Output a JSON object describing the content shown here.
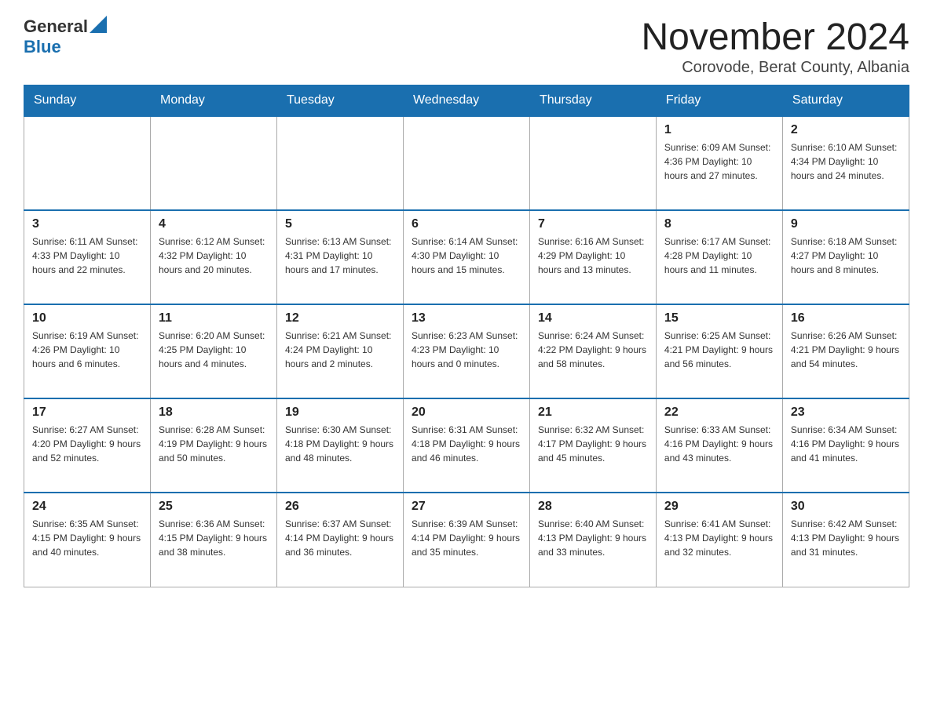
{
  "header": {
    "logo_general": "General",
    "logo_blue": "Blue",
    "title": "November 2024",
    "subtitle": "Corovode, Berat County, Albania"
  },
  "weekdays": [
    "Sunday",
    "Monday",
    "Tuesday",
    "Wednesday",
    "Thursday",
    "Friday",
    "Saturday"
  ],
  "weeks": [
    [
      {
        "day": "",
        "info": ""
      },
      {
        "day": "",
        "info": ""
      },
      {
        "day": "",
        "info": ""
      },
      {
        "day": "",
        "info": ""
      },
      {
        "day": "",
        "info": ""
      },
      {
        "day": "1",
        "info": "Sunrise: 6:09 AM\nSunset: 4:36 PM\nDaylight: 10 hours and 27 minutes."
      },
      {
        "day": "2",
        "info": "Sunrise: 6:10 AM\nSunset: 4:34 PM\nDaylight: 10 hours and 24 minutes."
      }
    ],
    [
      {
        "day": "3",
        "info": "Sunrise: 6:11 AM\nSunset: 4:33 PM\nDaylight: 10 hours and 22 minutes."
      },
      {
        "day": "4",
        "info": "Sunrise: 6:12 AM\nSunset: 4:32 PM\nDaylight: 10 hours and 20 minutes."
      },
      {
        "day": "5",
        "info": "Sunrise: 6:13 AM\nSunset: 4:31 PM\nDaylight: 10 hours and 17 minutes."
      },
      {
        "day": "6",
        "info": "Sunrise: 6:14 AM\nSunset: 4:30 PM\nDaylight: 10 hours and 15 minutes."
      },
      {
        "day": "7",
        "info": "Sunrise: 6:16 AM\nSunset: 4:29 PM\nDaylight: 10 hours and 13 minutes."
      },
      {
        "day": "8",
        "info": "Sunrise: 6:17 AM\nSunset: 4:28 PM\nDaylight: 10 hours and 11 minutes."
      },
      {
        "day": "9",
        "info": "Sunrise: 6:18 AM\nSunset: 4:27 PM\nDaylight: 10 hours and 8 minutes."
      }
    ],
    [
      {
        "day": "10",
        "info": "Sunrise: 6:19 AM\nSunset: 4:26 PM\nDaylight: 10 hours and 6 minutes."
      },
      {
        "day": "11",
        "info": "Sunrise: 6:20 AM\nSunset: 4:25 PM\nDaylight: 10 hours and 4 minutes."
      },
      {
        "day": "12",
        "info": "Sunrise: 6:21 AM\nSunset: 4:24 PM\nDaylight: 10 hours and 2 minutes."
      },
      {
        "day": "13",
        "info": "Sunrise: 6:23 AM\nSunset: 4:23 PM\nDaylight: 10 hours and 0 minutes."
      },
      {
        "day": "14",
        "info": "Sunrise: 6:24 AM\nSunset: 4:22 PM\nDaylight: 9 hours and 58 minutes."
      },
      {
        "day": "15",
        "info": "Sunrise: 6:25 AM\nSunset: 4:21 PM\nDaylight: 9 hours and 56 minutes."
      },
      {
        "day": "16",
        "info": "Sunrise: 6:26 AM\nSunset: 4:21 PM\nDaylight: 9 hours and 54 minutes."
      }
    ],
    [
      {
        "day": "17",
        "info": "Sunrise: 6:27 AM\nSunset: 4:20 PM\nDaylight: 9 hours and 52 minutes."
      },
      {
        "day": "18",
        "info": "Sunrise: 6:28 AM\nSunset: 4:19 PM\nDaylight: 9 hours and 50 minutes."
      },
      {
        "day": "19",
        "info": "Sunrise: 6:30 AM\nSunset: 4:18 PM\nDaylight: 9 hours and 48 minutes."
      },
      {
        "day": "20",
        "info": "Sunrise: 6:31 AM\nSunset: 4:18 PM\nDaylight: 9 hours and 46 minutes."
      },
      {
        "day": "21",
        "info": "Sunrise: 6:32 AM\nSunset: 4:17 PM\nDaylight: 9 hours and 45 minutes."
      },
      {
        "day": "22",
        "info": "Sunrise: 6:33 AM\nSunset: 4:16 PM\nDaylight: 9 hours and 43 minutes."
      },
      {
        "day": "23",
        "info": "Sunrise: 6:34 AM\nSunset: 4:16 PM\nDaylight: 9 hours and 41 minutes."
      }
    ],
    [
      {
        "day": "24",
        "info": "Sunrise: 6:35 AM\nSunset: 4:15 PM\nDaylight: 9 hours and 40 minutes."
      },
      {
        "day": "25",
        "info": "Sunrise: 6:36 AM\nSunset: 4:15 PM\nDaylight: 9 hours and 38 minutes."
      },
      {
        "day": "26",
        "info": "Sunrise: 6:37 AM\nSunset: 4:14 PM\nDaylight: 9 hours and 36 minutes."
      },
      {
        "day": "27",
        "info": "Sunrise: 6:39 AM\nSunset: 4:14 PM\nDaylight: 9 hours and 35 minutes."
      },
      {
        "day": "28",
        "info": "Sunrise: 6:40 AM\nSunset: 4:13 PM\nDaylight: 9 hours and 33 minutes."
      },
      {
        "day": "29",
        "info": "Sunrise: 6:41 AM\nSunset: 4:13 PM\nDaylight: 9 hours and 32 minutes."
      },
      {
        "day": "30",
        "info": "Sunrise: 6:42 AM\nSunset: 4:13 PM\nDaylight: 9 hours and 31 minutes."
      }
    ]
  ]
}
